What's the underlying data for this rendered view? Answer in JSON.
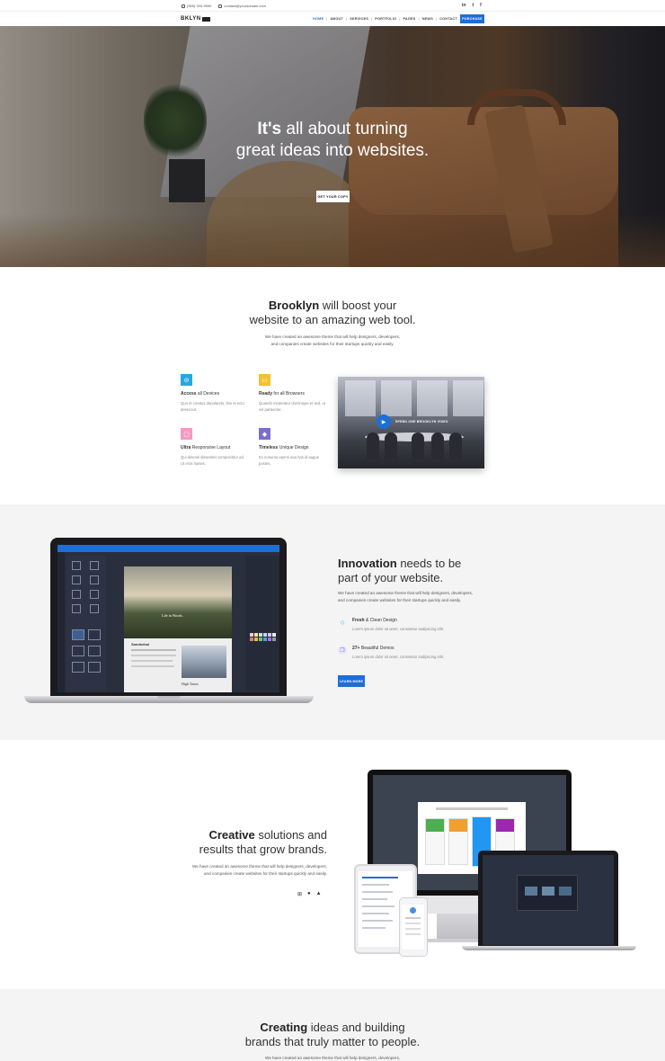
{
  "topbar": {
    "phone": "(555) 333-9990",
    "email": "contact@yourdomain.com",
    "social": [
      "in",
      "t",
      "f"
    ]
  },
  "nav": {
    "logo": "BKLYN",
    "items": [
      "HOME",
      "ABOUT",
      "SERVICES",
      "PORTFOLIO",
      "PAGES",
      "NEWS",
      "CONTACT",
      "DEMOS"
    ],
    "active": "HOME",
    "purchase": "PURCHASE"
  },
  "hero": {
    "title_bold": "It's",
    "title_rest_1": " all about turning",
    "title_line_2": "great ideas into websites.",
    "button": "GET YOUR COPY"
  },
  "boost": {
    "title_bold": "Brooklyn",
    "title_rest_1": " will boost your",
    "title_line_2": "website to an amazing web tool.",
    "text_1": "We have created an awesome theme that will help designers, developers,",
    "text_2": "and companies create websites for their startups quickly and easily.",
    "features": [
      {
        "bold": "Access",
        "rest": " all Devices",
        "desc": "Quo et creatus depulando, this et ecto desecout."
      },
      {
        "bold": "Ready",
        "rest": " for all Browsers",
        "desc": "Quando moderatur dominique et sed, ut vel partender."
      },
      {
        "bold": "Ultra",
        "rest": " Responsive Layout",
        "desc": "Qui deleniti dissenitet comprectitur ad. Ut eros haises."
      },
      {
        "bold": "Timeless",
        "rest": " Unique Design",
        "desc": "Ex nonuma eperni saa has id augue postes."
      }
    ],
    "video_caption": "SPEND ONE BROOKLYN VIDEO",
    "colors": [
      "#26a8e0",
      "#f2c12e",
      "#f49ac1",
      "#7b6fc6"
    ]
  },
  "innovation": {
    "title_bold": "Innovation",
    "title_rest_1": " needs to be",
    "title_line_2": "part of your website.",
    "text_1": "We have created an awesome theme that will help designers, developers,",
    "text_2": "and companies create websites for their startups quickly and easily.",
    "features": [
      {
        "bold": "Fresh",
        "rest": " & Clean Design",
        "desc": "Lorem ipsum dolor sit amet, consetetur sadipscing elitr."
      },
      {
        "bold": "27+",
        "rest": " Beautiful Demos",
        "desc": "Lorem ipsum dolor sit amet, consetetur sadipscing elitr."
      }
    ],
    "button": "LEARN MORE",
    "screen_caption": "Life in Woods.",
    "article_title": "Sandsebai",
    "article_right": "High Tatras",
    "laptop_label": "MacBook"
  },
  "creative": {
    "title_bold": "Creative",
    "title_rest_1": " solutions and",
    "title_line_2": "results that grow brands.",
    "text_1": "We have created an awesome theme that will help designers, developers,",
    "text_2": "and companies create websites for their startups quickly and easily.",
    "platforms": [
      "windows-icon",
      "apple-icon",
      "android-icon"
    ]
  },
  "creating": {
    "title_bold": "Creating",
    "title_rest_1": " ideas and building",
    "title_line_2": "brands that truly matter to people.",
    "text_1": "We have created an awesome theme that will help designers, developers,"
  }
}
